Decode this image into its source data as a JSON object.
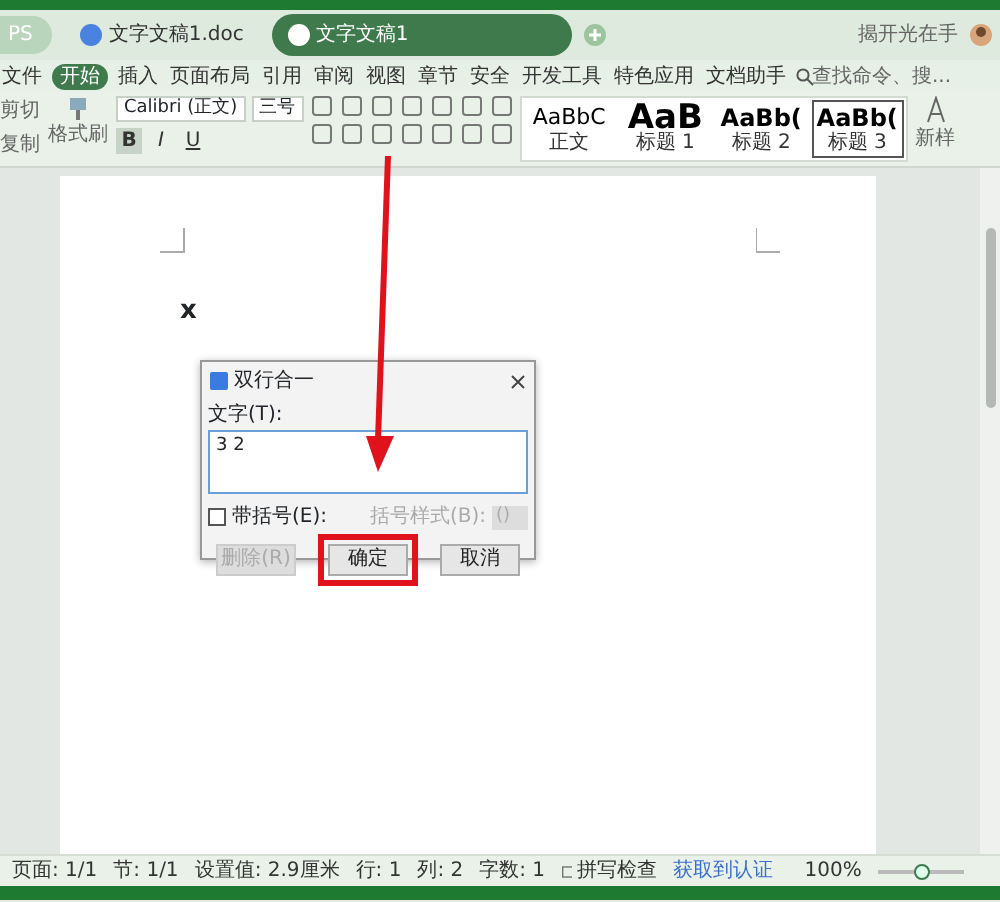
{
  "app_button": {
    "label": "PS"
  },
  "tabs": [
    {
      "label": "文字文稿1.doc",
      "selected": false
    },
    {
      "label": "文字文稿1",
      "selected": true
    }
  ],
  "user": {
    "name": "揭开光在手"
  },
  "menu": {
    "file": "文件",
    "items": [
      {
        "label": "开始",
        "selected": true
      },
      {
        "label": "插入",
        "selected": false
      },
      {
        "label": "页面布局",
        "selected": false
      },
      {
        "label": "引用",
        "selected": false
      },
      {
        "label": "审阅",
        "selected": false
      },
      {
        "label": "视图",
        "selected": false
      },
      {
        "label": "章节",
        "selected": false
      },
      {
        "label": "安全",
        "selected": false
      },
      {
        "label": "开发工具",
        "selected": false
      },
      {
        "label": "特色应用",
        "selected": false
      },
      {
        "label": "文档助手",
        "selected": false
      }
    ],
    "search": {
      "placeholder": "查找命令、搜..."
    }
  },
  "ribbon": {
    "cut": "剪切",
    "copy": "复制",
    "format_painter": "格式刷",
    "font": "Calibri (正文)",
    "size": "三号",
    "format_buttons": [
      {
        "label": "B",
        "selected": true
      },
      {
        "label": "I",
        "selected": false
      },
      {
        "label": "U",
        "selected": false
      }
    ],
    "styles": [
      {
        "sample": "AaBbC",
        "label": "正文",
        "selected": false,
        "kind": "normal"
      },
      {
        "sample": "AaB",
        "label": "标题 1",
        "selected": false,
        "kind": "big"
      },
      {
        "sample": "AaBb(",
        "label": "标题 2",
        "selected": false,
        "kind": "mid"
      },
      {
        "sample": "AaBb(",
        "label": "标题 3",
        "selected": true,
        "kind": "mid"
      }
    ],
    "new_style": "新样"
  },
  "document": {
    "text": "x"
  },
  "dialog": {
    "title": "双行合一",
    "text_label": "文字(T):",
    "text_value": "3 2",
    "brackets": {
      "label": "带括号(E):",
      "checked": false
    },
    "bracket_style": {
      "label": "括号样式(B):",
      "value": "()",
      "disabled": true
    },
    "buttons": [
      {
        "label": "删除(R)",
        "disabled": true,
        "highlighted": false
      },
      {
        "label": "确定",
        "disabled": false,
        "highlighted": true
      },
      {
        "label": "取消",
        "disabled": false,
        "highlighted": false
      }
    ]
  },
  "status_bar": {
    "items": [
      "页面: 1/1",
      "节: 1/1",
      "设置值: 2.9厘米",
      "行: 1",
      "列: 2",
      "字数: 1"
    ],
    "spell_check": "拼写检查",
    "link": "获取到认证",
    "zoom": "100%",
    "zoom_slider": {
      "level": 0.52
    }
  }
}
